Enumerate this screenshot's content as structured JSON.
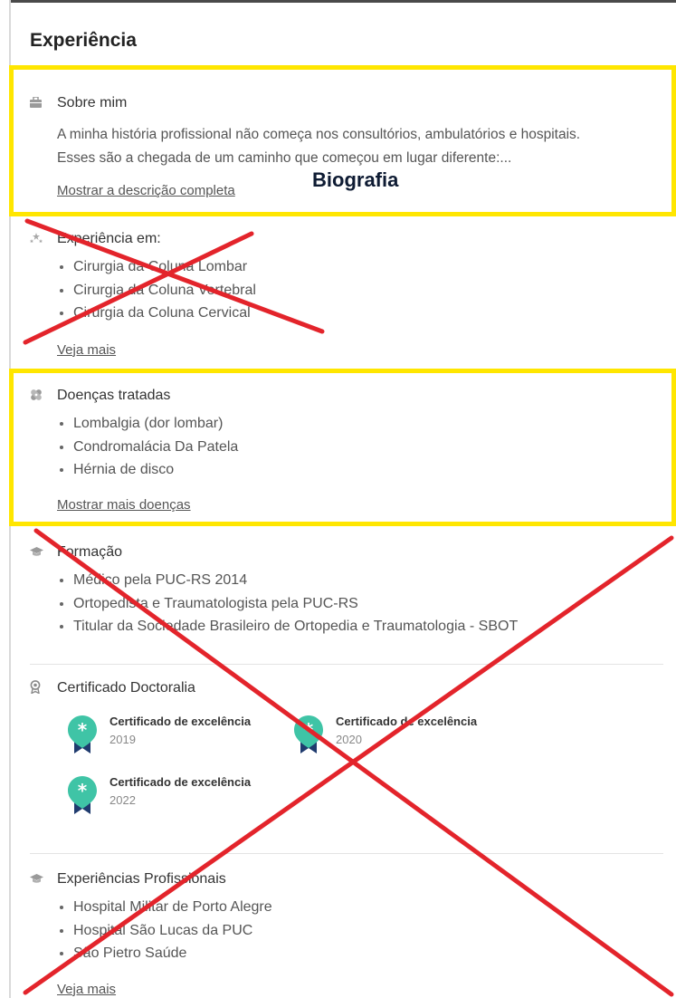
{
  "title": "Experiência",
  "annotation": "Biografia",
  "about": {
    "heading": "Sobre mim",
    "line1": "A minha história profissional não começa nos consultórios, ambulatórios e hospitais.",
    "line2": "Esses são a chegada de um caminho que começou em lugar diferente:...",
    "link": "Mostrar a descrição completa"
  },
  "experience_in": {
    "heading": "Experiência em:",
    "items": [
      "Cirurgia da Coluna Lombar",
      "Cirurgia da Coluna Vertebral",
      "Cirurgia da Coluna Cervical"
    ],
    "link": "Veja mais"
  },
  "diseases": {
    "heading": "Doenças tratadas",
    "items": [
      "Lombalgia (dor lombar)",
      "Condromalácia Da Patela",
      "Hérnia de disco"
    ],
    "link": "Mostrar mais doenças"
  },
  "education": {
    "heading": "Formação",
    "items": [
      "Médico pela PUC-RS 2014",
      "Ortopedista e Traumatologista pela PUC-RS",
      "Titular da Sociedade Brasileiro de Ortopedia e Traumatologia - SBOT"
    ]
  },
  "certificates": {
    "heading": "Certificado Doctoralia",
    "items": [
      {
        "title": "Certificado de excelência",
        "year": "2019"
      },
      {
        "title": "Certificado de excelência",
        "year": "2020"
      },
      {
        "title": "Certificado de excelência",
        "year": "2022"
      }
    ]
  },
  "professional": {
    "heading": "Experiências Profissionais",
    "items": [
      "Hospital Militar de Porto Alegre",
      "Hospital São Lucas da PUC",
      "São Pietro Saúde"
    ],
    "link": "Veja mais"
  },
  "colors": {
    "highlight": "#ffe600",
    "cross": "#e3242b",
    "badge": "#3fc4a6",
    "ribbon": "#1f3b6e"
  },
  "icons": [
    "briefcase-icon",
    "stars-icon",
    "bandage-icon",
    "graduation-cap-icon",
    "award-icon"
  ]
}
